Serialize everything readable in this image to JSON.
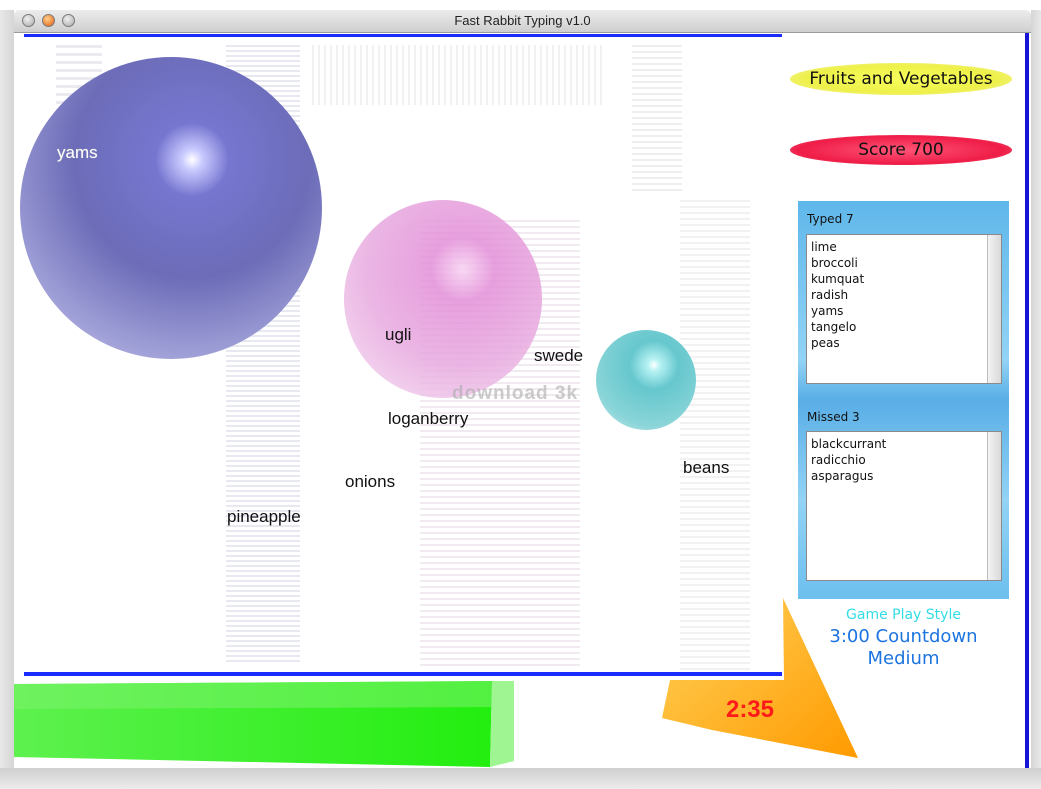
{
  "window": {
    "title": "Fast Rabbit Typing v1.0"
  },
  "category": "Fruits and Vegetables",
  "score_label": "Score 700",
  "falling_words": [
    "yams",
    "pineapple",
    "ugli",
    "swede",
    "loganberry",
    "onions",
    "beans"
  ],
  "watermark": "download 3k",
  "typed": {
    "title": "Typed 7",
    "items": [
      "lime",
      "broccoli",
      "kumquat",
      "radish",
      "yams",
      "tangelo",
      "peas"
    ]
  },
  "missed": {
    "title": "Missed 3",
    "items": [
      "blackcurrant",
      "radicchio",
      "asparagus"
    ]
  },
  "game_play_style": {
    "label": "Game Play Style",
    "mode": "3:00 Countdown",
    "difficulty": "Medium"
  },
  "timer": "2:35",
  "colors": {
    "category_pill": "#f2f54a",
    "score_pill": "#ef1d48",
    "list_panel": "#6dbfee",
    "timer_text": "#ff1a1a",
    "time_bar": "#2ef01a",
    "border_blue": "#1a2bff"
  }
}
